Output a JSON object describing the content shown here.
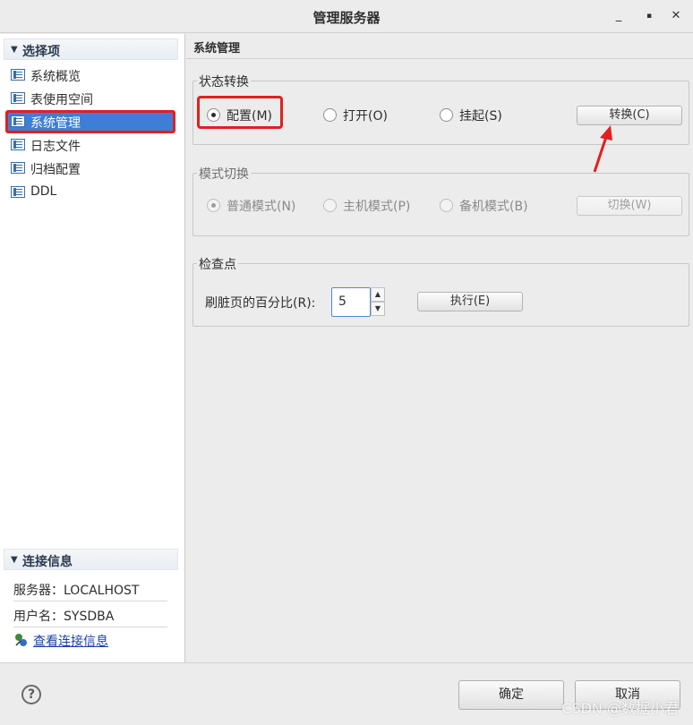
{
  "window": {
    "title": "管理服务器",
    "minimize_glyph": "_",
    "maximize_glyph": "▪",
    "close_glyph": "✕"
  },
  "sidebar": {
    "select_header": "选择项",
    "items": [
      {
        "label": "系统概览",
        "icon": "table-icon"
      },
      {
        "label": "表使用空间",
        "icon": "table-icon"
      },
      {
        "label": "系统管理",
        "icon": "table-icon",
        "selected": true
      },
      {
        "label": "日志文件",
        "icon": "table-icon"
      },
      {
        "label": "归档配置",
        "icon": "table-icon"
      },
      {
        "label": "DDL",
        "icon": "table-icon"
      }
    ],
    "connection_header": "连接信息",
    "server_row": "服务器：LOCALHOST",
    "user_row": "用户名：SYSDBA",
    "view_link": "查看连接信息"
  },
  "main": {
    "title": "系统管理",
    "state_group": {
      "title": "状态转换",
      "options": [
        "配置(M)",
        "打开(O)",
        "挂起(S)"
      ],
      "selected_index": 0,
      "button": "转换(C)"
    },
    "mode_group": {
      "title": "模式切换",
      "options": [
        "普通模式(N)",
        "主机模式(P)",
        "备机模式(B)"
      ],
      "selected_index": 0,
      "button": "切换(W)",
      "disabled": true
    },
    "checkpoint_group": {
      "title": "检查点",
      "label": "刷脏页的百分比(R):",
      "value": "5",
      "button": "执行(E)"
    }
  },
  "footer": {
    "help_glyph": "?",
    "ok": "确定",
    "cancel": "取消"
  },
  "watermark": "CSDN @数据小君",
  "colors": {
    "selection": "#3d7fd6",
    "annotation": "#e02020",
    "link": "#1a3fa8"
  }
}
